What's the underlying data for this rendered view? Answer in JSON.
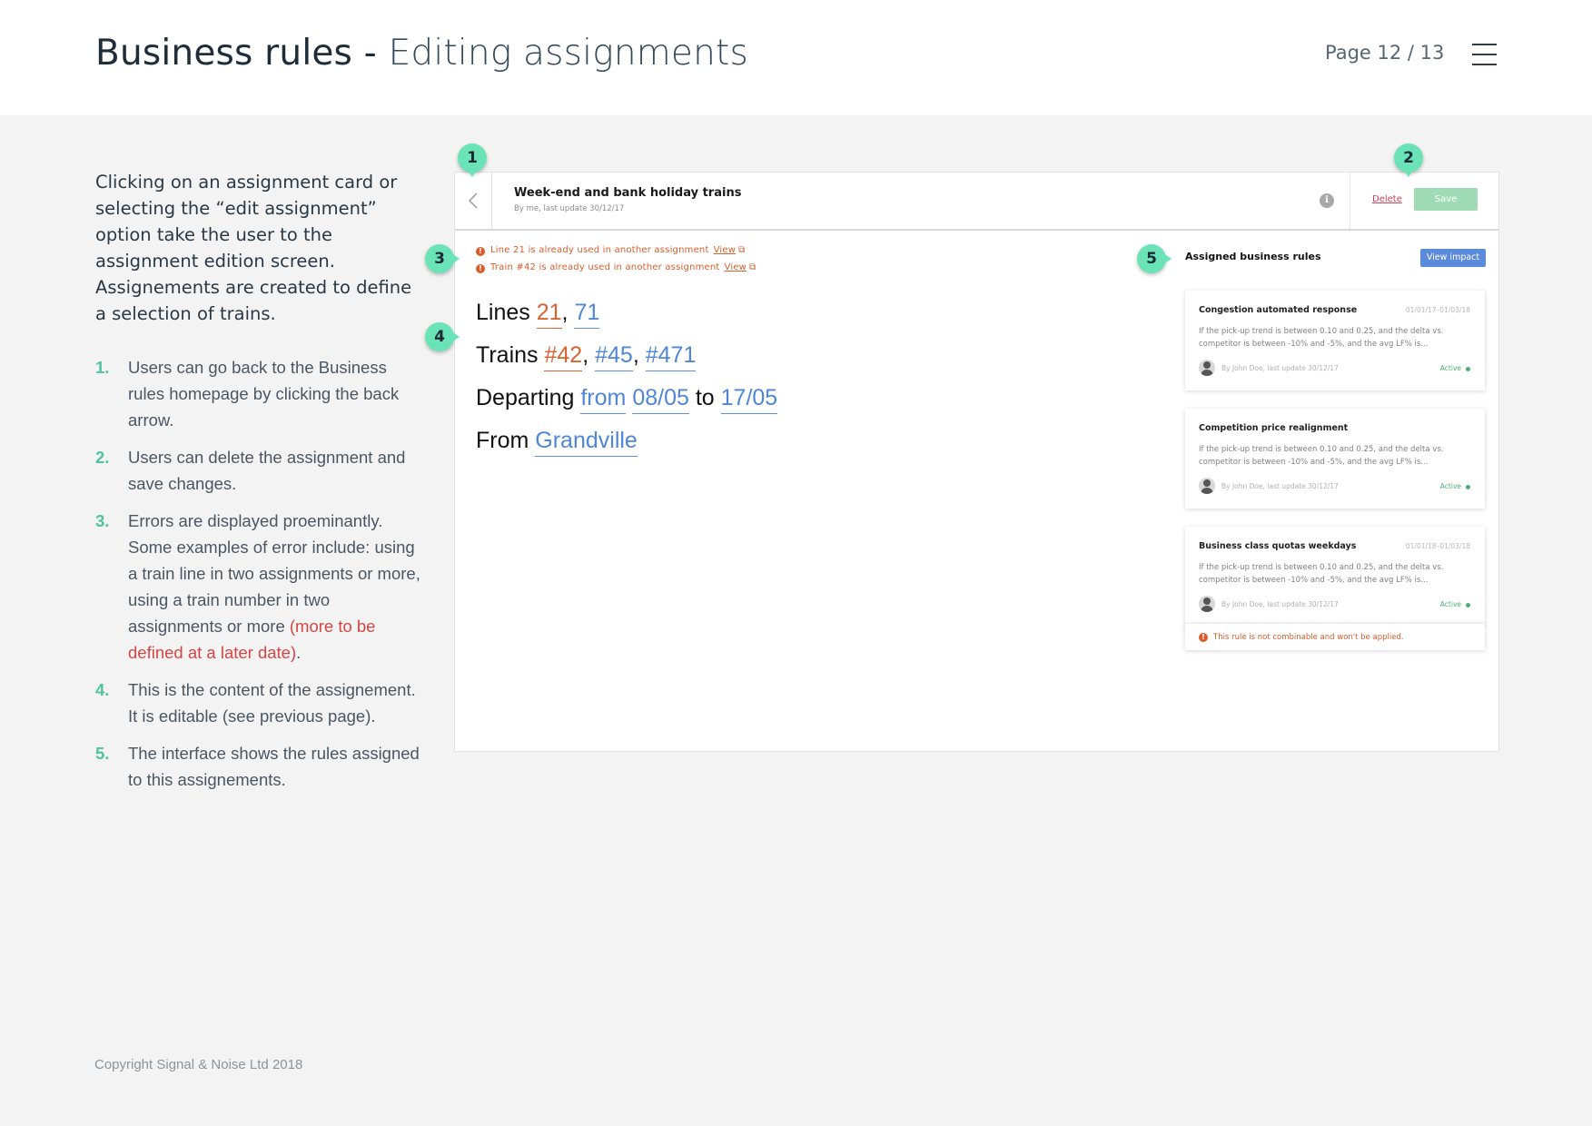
{
  "header": {
    "title_bold": "Business rules -",
    "title_light": "Editing assignments",
    "page_label": "Page 12 / 13",
    "menu_icon": "hamburger-menu-icon"
  },
  "intro": "Clicking on an assignment card or selecting the “edit assignment” option take the user to the assignment edition screen. Assignements are created to define a selection of trains.",
  "notes": [
    {
      "num": "1.",
      "text": "Users can go back to the Business rules homepage by clicking the back arrow."
    },
    {
      "num": "2.",
      "text": "Users can delete the assignment and save changes."
    },
    {
      "num": "3.",
      "text": "Errors are displayed proeminantly. Some examples of error include: using a train line in two assignments or more, using a train number in two assignments or more ",
      "highlight": "(more to be defined at a later date)",
      "after": "."
    },
    {
      "num": "4.",
      "text": "This is the content of the assignement. It is editable (see previous page)."
    },
    {
      "num": "5.",
      "text": "The interface shows the rules assigned to this assignements."
    }
  ],
  "footer": "Copyright Signal & Noise Ltd 2018",
  "badges": [
    "1",
    "2",
    "3",
    "4",
    "5"
  ],
  "mockup": {
    "back_icon": "chevron-left-icon",
    "title": "Week-end and bank holiday trains",
    "subtitle": "By me, last update 30/12/17",
    "info_icon": "info-icon",
    "info_glyph": "i",
    "delete_label": "Delete",
    "save_label": "Save",
    "errors": [
      {
        "text": "Line 21 is already used in another assignment",
        "link": "View"
      },
      {
        "text": "Train #42 is already used in another assignment",
        "link": "View"
      }
    ],
    "error_glyph": "!",
    "external_glyph": "⧉",
    "content": {
      "lines_label": "Lines",
      "lines": [
        "21",
        "71"
      ],
      "trains_label": "Trains",
      "trains": [
        "#42",
        "#45",
        "#471"
      ],
      "departing_label": "Departing",
      "departing_from": "from",
      "date_from": "08/05",
      "departing_to": "to",
      "date_to": "17/05",
      "from_label": "From",
      "station": "Grandville",
      "separator": ","
    },
    "rules_title": "Assigned business rules",
    "view_impact_label": "View impact",
    "rules": [
      {
        "title": "Congestion automated response",
        "date": "01/01/17–01/03/18",
        "body": "If the pick-up trend is between 0.10 and 0.25, and the delta vs. competitor is between -10% and -5%, and the avg LF% is...",
        "meta": "By John Doe, last update 30/12/17",
        "status": "Active"
      },
      {
        "title": "Competition price realignment",
        "date": "",
        "body": "If the pick-up trend is between 0.10 and 0.25, and the delta vs. competitor is between -10% and -5%, and the avg LF% is...",
        "meta": "By John Doe, last update 30/12/17",
        "status": "Active"
      },
      {
        "title": "Business class quotas weekdays",
        "date": "01/01/18–01/03/18",
        "body": "If the pick-up trend is between 0.10 and 0.25, and the delta vs. competitor is between -10% and -5%, and the avg LF% is...",
        "meta": "By John Doe, last update 30/12/17",
        "status": "Active"
      }
    ],
    "rule_warning": "This rule is not combinable and won't be applied.",
    "colors": {
      "accent_green": "#6be3b9",
      "error": "#d85c2c",
      "link_blue": "#4f86d6",
      "save_green": "#9fdcb6",
      "active_green": "#4caf74"
    }
  }
}
